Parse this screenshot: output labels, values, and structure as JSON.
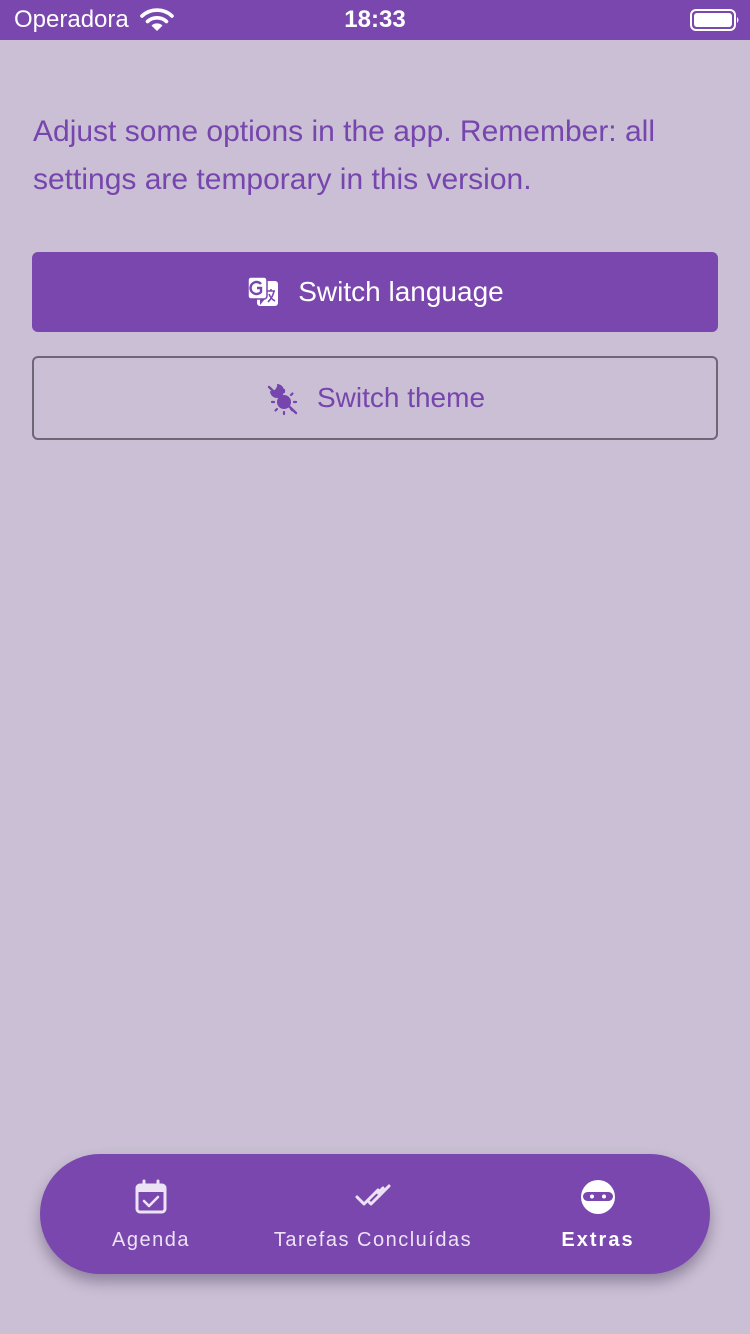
{
  "status_bar": {
    "carrier": "Operadora",
    "time": "18:33",
    "wifi_icon": "wifi-icon",
    "battery_icon": "battery-full-icon"
  },
  "content": {
    "description": "Adjust some options in the app. Remember: all settings are temporary in this version.",
    "buttons": [
      {
        "label": "Switch language",
        "icon": "translate-icon",
        "style": "filled"
      },
      {
        "label": "Switch theme",
        "icon": "theme-icon",
        "style": "outlined"
      }
    ]
  },
  "bottom_nav": {
    "items": [
      {
        "label": "Agenda",
        "icon": "calendar-check-icon",
        "selected": false
      },
      {
        "label": "Tarefas Concluídas",
        "icon": "done-all-icon",
        "selected": false
      },
      {
        "label": "Extras",
        "icon": "ninja-icon",
        "selected": true
      }
    ]
  },
  "colors": {
    "primary": "#7947ae",
    "background": "#cabfd4",
    "text_accent": "#7645ad",
    "outline": "#6e6776",
    "on_primary": "#ffffff"
  }
}
